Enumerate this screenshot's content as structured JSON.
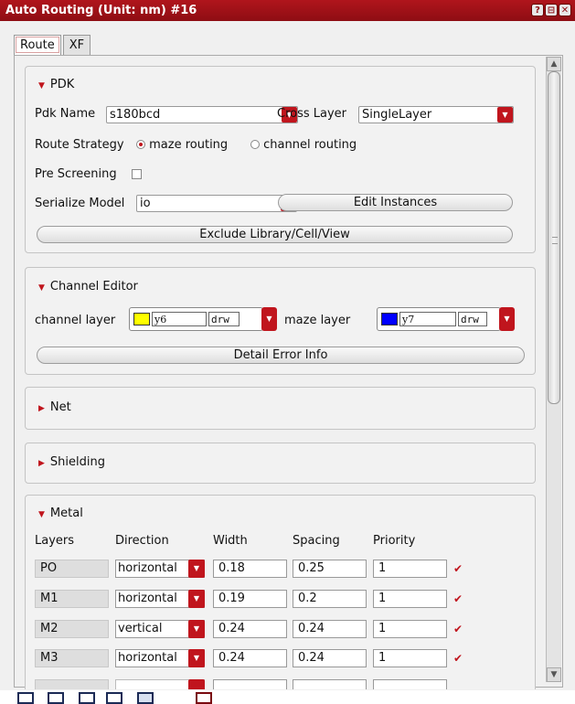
{
  "window": {
    "title": "Auto Routing (Unit: nm) #16",
    "help_glyph": "?",
    "restore_glyph": "⊟",
    "close_glyph": "✕"
  },
  "tabs": [
    {
      "label": "Route",
      "active": true
    },
    {
      "label": "XF",
      "active": false
    }
  ],
  "pdk": {
    "header": "PDK",
    "pdk_name_label": "Pdk Name",
    "pdk_name_value": "s180bcd",
    "cross_layer_label": "Cross Layer",
    "cross_layer_value": "SingleLayer",
    "route_strategy_label": "Route Strategy",
    "route_strategy_options": [
      "maze routing",
      "channel routing"
    ],
    "route_strategy_selected": "maze routing",
    "pre_screening_label": "Pre Screening",
    "pre_screening_checked": false,
    "serialize_model_label": "Serialize Model",
    "serialize_model_value": "io",
    "edit_instances_label": "Edit Instances",
    "exclude_label": "Exclude Library/Cell/View"
  },
  "channel_editor": {
    "header": "Channel Editor",
    "channel_layer_label": "channel layer",
    "channel_layer": {
      "name": "y6",
      "purpose": "drw",
      "color": "#ffff00"
    },
    "maze_layer_label": "maze layer",
    "maze_layer": {
      "name": "y7",
      "purpose": "drw",
      "color": "#0000ff"
    },
    "detail_error_label": "Detail Error Info"
  },
  "net": {
    "header": "Net",
    "expanded": false
  },
  "shielding": {
    "header": "Shielding",
    "expanded": false
  },
  "metal": {
    "header": "Metal",
    "columns": [
      "Layers",
      "Direction",
      "Width",
      "Spacing",
      "Priority"
    ],
    "rows": [
      {
        "layer": "PO",
        "direction": "horizontal",
        "width": "0.18",
        "spacing": "0.25",
        "priority": "1",
        "enabled": true
      },
      {
        "layer": "M1",
        "direction": "horizontal",
        "width": "0.19",
        "spacing": "0.2",
        "priority": "1",
        "enabled": true
      },
      {
        "layer": "M2",
        "direction": "vertical",
        "width": "0.24",
        "spacing": "0.24",
        "priority": "1",
        "enabled": true
      },
      {
        "layer": "M3",
        "direction": "horizontal",
        "width": "0.24",
        "spacing": "0.24",
        "priority": "1",
        "enabled": true
      }
    ]
  },
  "colors": {
    "accent": "#c0151d",
    "title_bar": "#9e1017"
  }
}
